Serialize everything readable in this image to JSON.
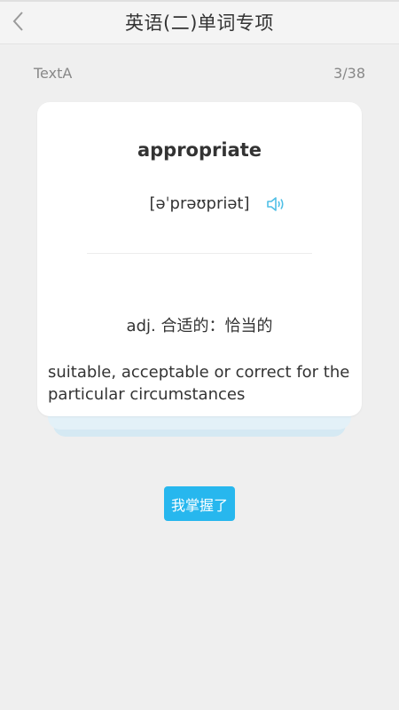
{
  "header": {
    "title": "英语(二)单词专项",
    "back_icon": "chevron-left-icon"
  },
  "subheader": {
    "text_name": "TextA",
    "progress": "3/38"
  },
  "card": {
    "word": "appropriate",
    "phonetic": "[əˈprəʊpriət]",
    "speaker_icon": "speaker-icon",
    "meaning": "adj.  合适的：恰当的",
    "definition": "suitable, acceptable or correct for the particular circumstances"
  },
  "actions": {
    "master_label": "我掌握了"
  },
  "colors": {
    "accent": "#27b7ee",
    "background": "#efefef",
    "card": "#ffffff"
  }
}
